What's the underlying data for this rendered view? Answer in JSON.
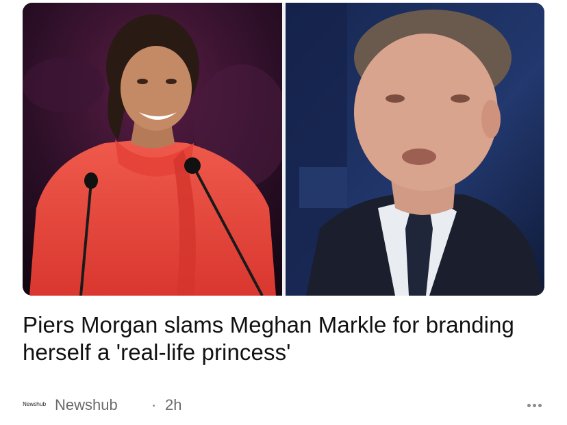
{
  "headline": "Piers Morgan slams Meghan Markle for branding herself a 'real-life princess'",
  "source": {
    "logo_text": "Newshub",
    "name": "Newshub",
    "separator": "·",
    "time": "2h"
  },
  "icons": {
    "more": "more-horizontal-icon"
  },
  "colors": {
    "headline": "#111111",
    "meta": "#6b6b6b",
    "left_photo_bg": "#3a1230",
    "left_photo_dress": "#e8483f",
    "right_photo_bg": "#1d2f5e",
    "right_photo_suit": "#1d2230"
  }
}
